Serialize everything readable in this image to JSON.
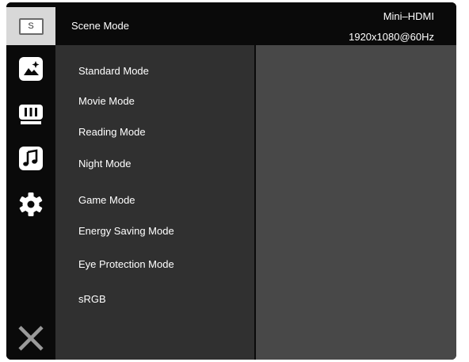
{
  "sidebar": {
    "items": [
      {
        "name": "scene-mode-icon",
        "glyph": "S"
      },
      {
        "name": "picture-icon"
      },
      {
        "name": "display-settings-icon"
      },
      {
        "name": "audio-icon"
      },
      {
        "name": "settings-gear-icon"
      },
      {
        "name": "close-icon"
      }
    ]
  },
  "header": {
    "title": "Scene Mode",
    "input_source": "Mini–HDMI",
    "resolution": "1920x1080@60Hz"
  },
  "menu": {
    "items": [
      "Standard Mode",
      "Movie Mode",
      "Reading Mode",
      "Night Mode",
      "Game Mode",
      "Energy Saving Mode",
      "Eye Protection Mode",
      "sRGB"
    ]
  },
  "colors": {
    "background": "#0a0a0a",
    "menu_panel": "#303030",
    "submenu_panel": "#484848",
    "active_tab": "#d8d8d8"
  }
}
